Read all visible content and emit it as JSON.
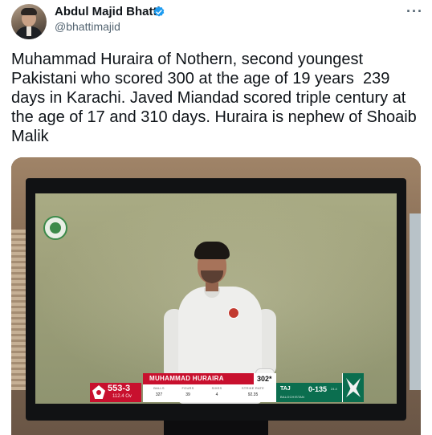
{
  "author": {
    "name": "Abdul Majid Bhatti",
    "handle": "@bhattimajid",
    "verified": true,
    "more_label": "···",
    "avatar_icon": "profile-photo"
  },
  "tweet": {
    "text": "Muhammad Huraira of Nothern, second youngest Pakistani who scored 300 at the age of 19 years  239 days in Karachi. Javed Miandad scored triple century at the age of 17 and 310 days. Huraira is nephew of Shoaib Malik"
  },
  "media": {
    "scoreboard": {
      "batting_score": "553-3",
      "batting_overs": "112.4 Ov",
      "batter_name": "MUHAMMAD HURAIRA",
      "batter_runs": "302*",
      "stats": [
        {
          "label": "BALLS",
          "value": "327"
        },
        {
          "label": "FOURS",
          "value": "39"
        },
        {
          "label": "SIXES",
          "value": "4"
        },
        {
          "label": "STRIKE RATE",
          "value": "92.35"
        }
      ],
      "bowler": "TAJ",
      "bowler_figures": "0-135",
      "bowler_overs": "24.4",
      "opponent_team": "BALOCHISTAN"
    }
  },
  "colors": {
    "text": "#0f1419",
    "secondary": "#536471",
    "verified_blue": "#1d9bf0",
    "score_red": "#c8102e",
    "score_green": "#0b6e4f"
  }
}
